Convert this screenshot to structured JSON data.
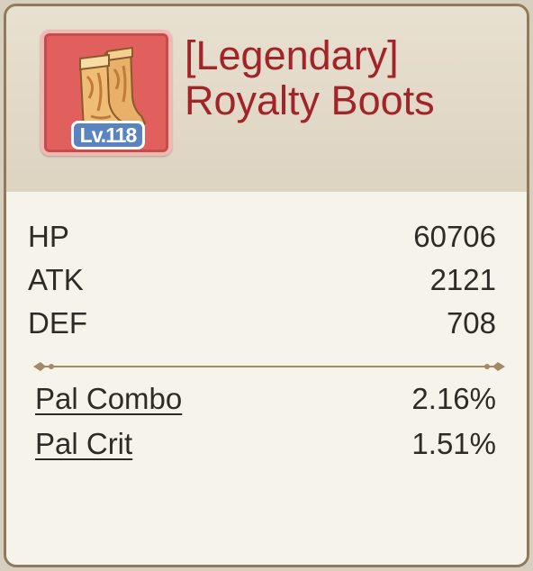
{
  "item": {
    "level_badge": "Lv.118",
    "rarity_tag": "[Legendary]",
    "name": "Royalty Boots",
    "icon": "boots-icon"
  },
  "base_stats": [
    {
      "label": "HP",
      "value": "60706"
    },
    {
      "label": "ATK",
      "value": "2121"
    },
    {
      "label": "DEF",
      "value": "708"
    }
  ],
  "bonus_stats": [
    {
      "label": "Pal Combo",
      "value": "2.16%"
    },
    {
      "label": "Pal Crit",
      "value": "1.51%"
    }
  ],
  "colors": {
    "rarity_frame": "#e15f5c",
    "title_text": "#a32428",
    "level_badge": "#5a84c0",
    "card_border": "#8f7a5c"
  }
}
